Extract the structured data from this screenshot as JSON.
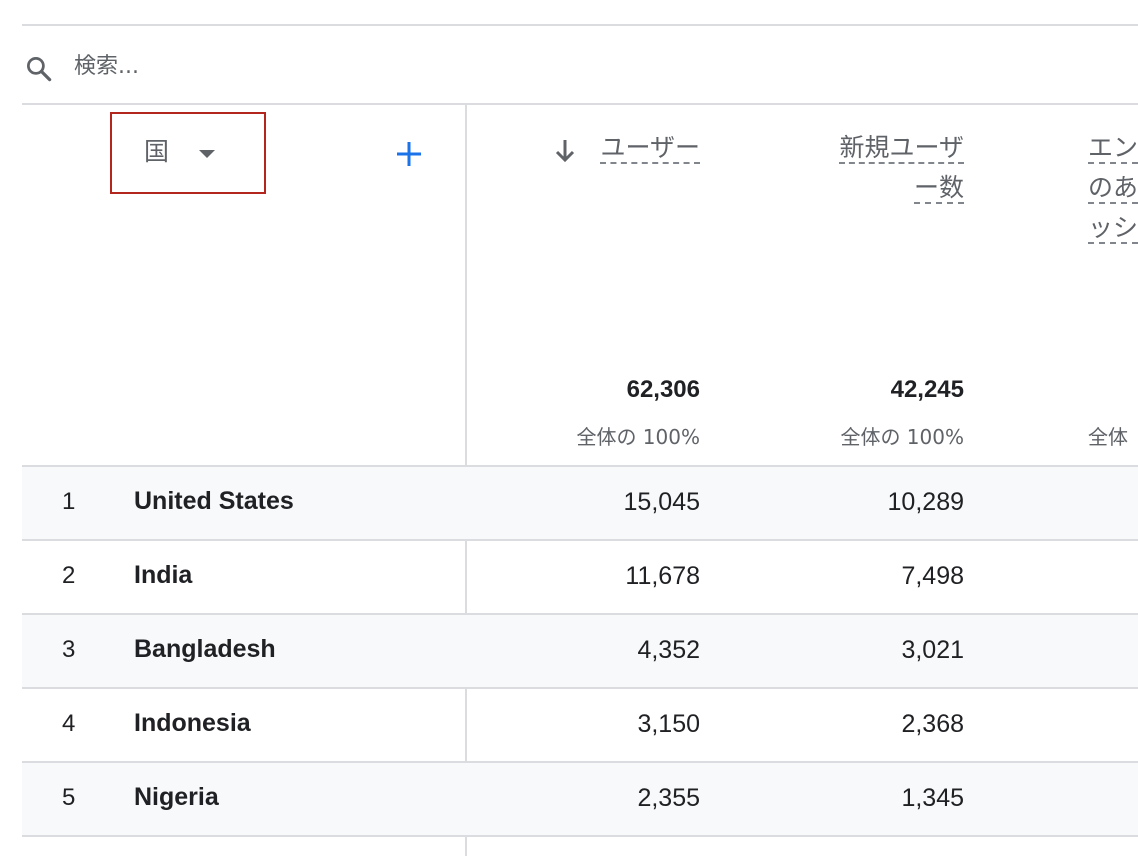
{
  "search": {
    "placeholder": "検索..."
  },
  "dimension": {
    "label": "国"
  },
  "metrics": [
    {
      "header_line1": "ユーザー",
      "header_line2": "",
      "total": "62,306",
      "share": "全体の 100%",
      "sorted": true
    },
    {
      "header_line1": "新規ユーザ",
      "header_line2": "ー数",
      "total": "42,245",
      "share": "全体の 100%",
      "sorted": false
    },
    {
      "header_line1": "エン",
      "header_line2": "のあ",
      "header_line3": "ッシ",
      "share": "全体",
      "sorted": false
    }
  ],
  "rows": [
    {
      "rank": "1",
      "country": "United States",
      "users": "15,045",
      "new_users": "10,289"
    },
    {
      "rank": "2",
      "country": "India",
      "users": "11,678",
      "new_users": "7,498"
    },
    {
      "rank": "3",
      "country": "Bangladesh",
      "users": "4,352",
      "new_users": "3,021"
    },
    {
      "rank": "4",
      "country": "Indonesia",
      "users": "3,150",
      "new_users": "2,368"
    },
    {
      "rank": "5",
      "country": "Nigeria",
      "users": "2,355",
      "new_users": "1,345"
    }
  ],
  "colors": {
    "highlight_border": "#b3261e",
    "add_button": "#1a73e8",
    "divider": "#dadce0",
    "row_shade": "#f8f9fa"
  },
  "icons": [
    "search-icon",
    "chevron-down-icon",
    "plus-icon",
    "arrow-down-icon"
  ]
}
